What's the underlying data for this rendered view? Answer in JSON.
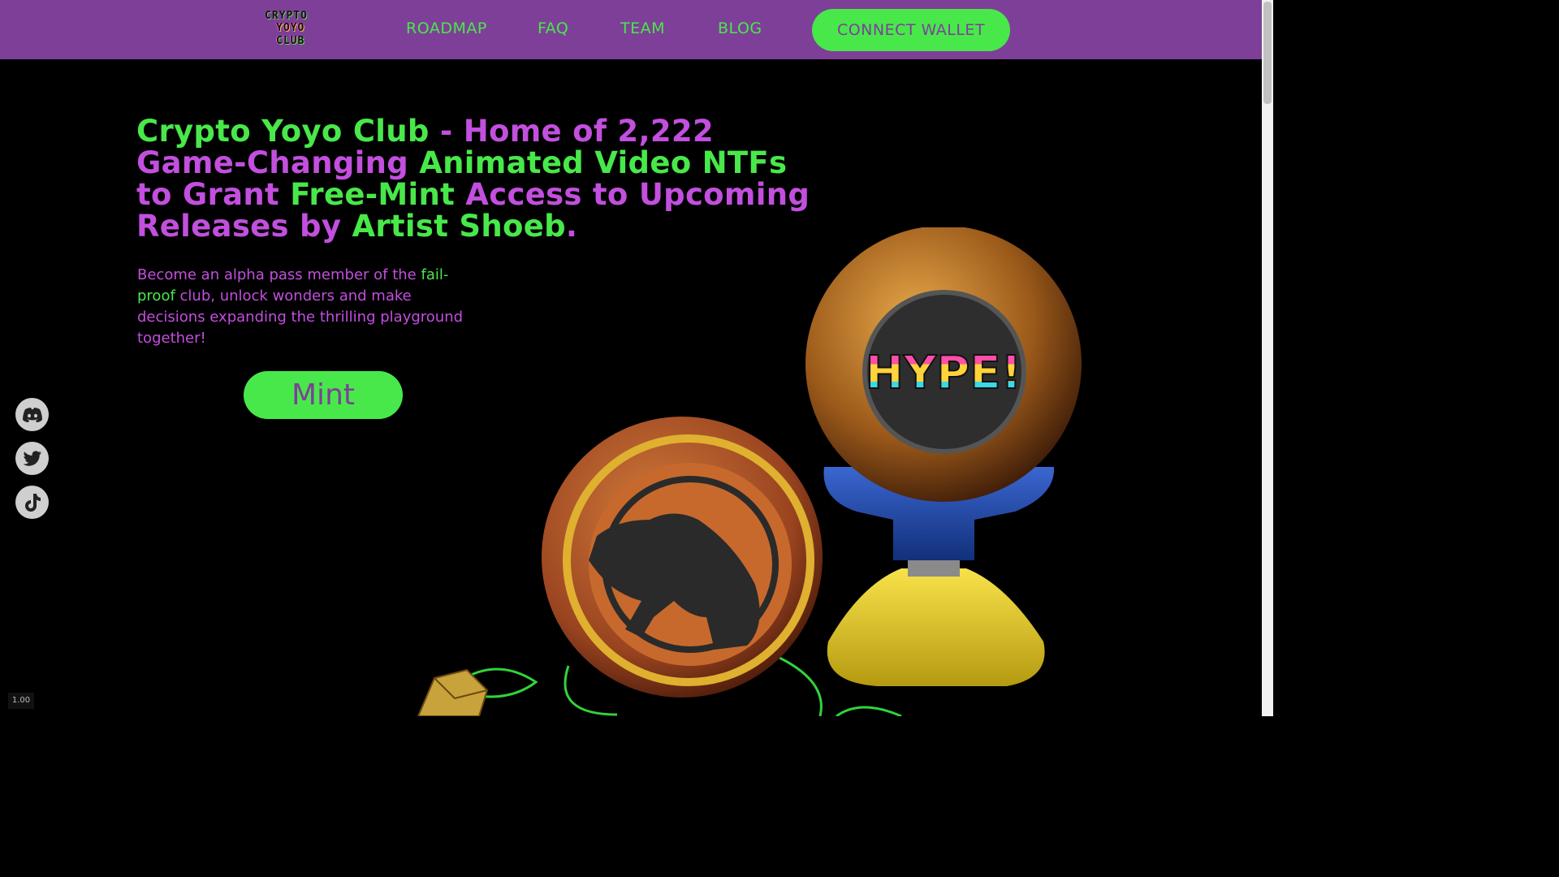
{
  "header": {
    "logo_lines": [
      "CRYPTO",
      "YOYO",
      "CLUB"
    ],
    "nav": [
      "ROADMAP",
      "FAQ",
      "TEAM",
      "BLOG"
    ],
    "connect_label": "CONNECT WALLET"
  },
  "hero": {
    "headline_parts": [
      {
        "text": "Crypto Yoyo Club",
        "color": "green"
      },
      {
        "text": " - Home of 2,222 Game-Changing ",
        "color": "purple"
      },
      {
        "text": "Animated Video NTFs",
        "color": "green"
      },
      {
        "text": " to Grant ",
        "color": "purple"
      },
      {
        "text": "Free-Mint",
        "color": "green"
      },
      {
        "text": " Access to Upcoming Releases by ",
        "color": "purple"
      },
      {
        "text": "Artist Shoeb",
        "color": "green"
      },
      {
        "text": ".",
        "color": "purple"
      }
    ],
    "intro_parts": [
      {
        "text": "Become an alpha pass member of the ",
        "color": "purple"
      },
      {
        "text": "fail-proof",
        "color": "green"
      },
      {
        "text": " club, unlock wonders and make decisions expanding the thrilling playground together!",
        "color": "purple"
      }
    ],
    "mint_label": "Mint"
  },
  "socials": [
    "discord-icon",
    "twitter-icon",
    "tiktok-icon"
  ],
  "yoyo_badge_text": "HYPE!",
  "zoom_badge": "1.00",
  "colors": {
    "purple": "#7e3f98",
    "headline_purple": "#c24fde",
    "green": "#48e84a"
  }
}
